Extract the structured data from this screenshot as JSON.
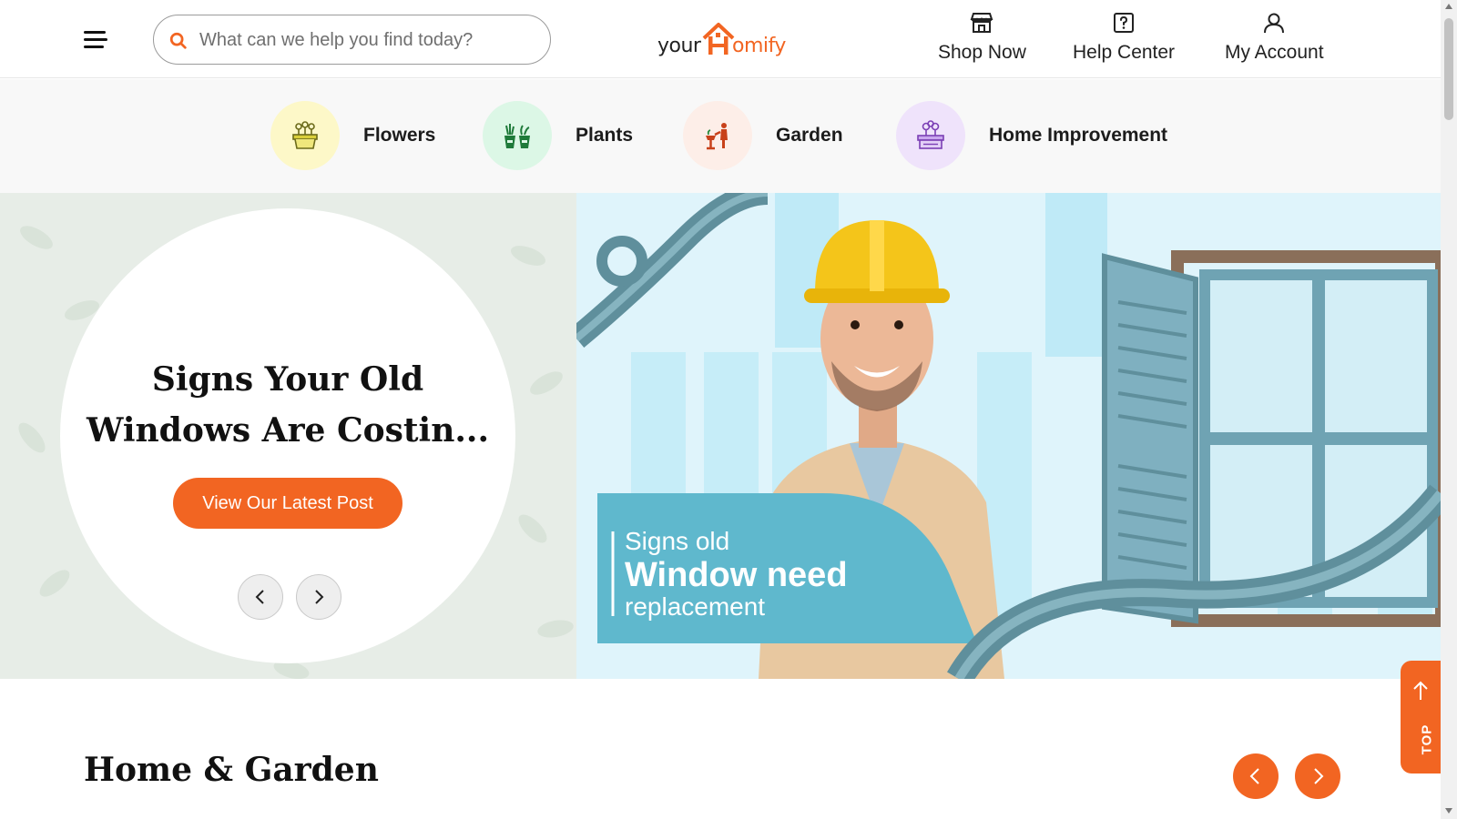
{
  "header": {
    "search_placeholder": "What can we help you find today?",
    "logo": {
      "part1": "your",
      "part2": "omify"
    },
    "nav": [
      {
        "label": "Shop Now",
        "icon": "store-icon"
      },
      {
        "label": "Help Center",
        "icon": "help-icon"
      },
      {
        "label": "My Account",
        "icon": "user-icon"
      }
    ]
  },
  "categories": [
    {
      "label": "Flowers",
      "icon": "flower-pot-icon",
      "bg": "#fdf8c8"
    },
    {
      "label": "Plants",
      "icon": "plant-pots-icon",
      "bg": "#dcf7e6"
    },
    {
      "label": "Garden",
      "icon": "gardener-icon",
      "bg": "#fdeee8"
    },
    {
      "label": "Home Improvement",
      "icon": "planter-box-icon",
      "bg": "#efe3fb"
    }
  ],
  "hero": {
    "title_line1": "Signs Your Old",
    "title_line2": "Windows Are Costin...",
    "button_label": "View Our Latest Post",
    "banner_small": "Signs old",
    "banner_big": "Window need",
    "banner_sub": "replacement"
  },
  "section": {
    "title": "Home & Garden"
  },
  "top_button": {
    "label": "TOP"
  },
  "colors": {
    "accent": "#f26522",
    "banner_blue": "#5fb8cd"
  }
}
